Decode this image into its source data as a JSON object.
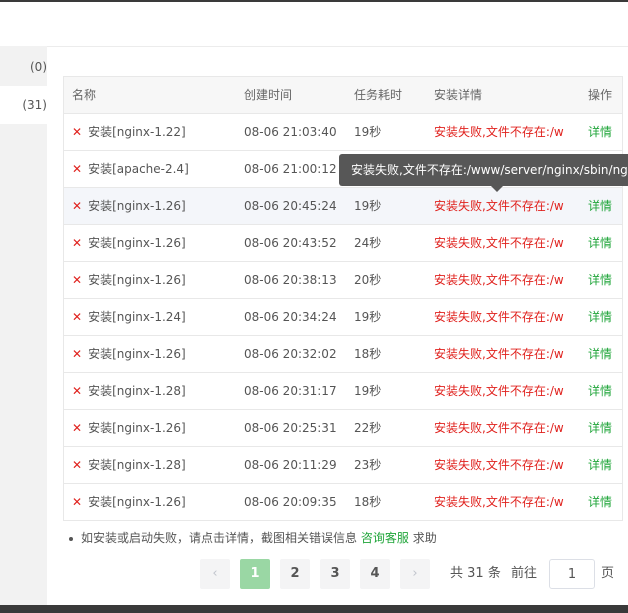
{
  "sidebar": {
    "items": [
      {
        "label": "(0)",
        "active": false
      },
      {
        "label": "(31)",
        "active": true
      },
      {
        "label": "",
        "active": false
      }
    ]
  },
  "table": {
    "headers": {
      "name": "名称",
      "time": "创建时间",
      "duration": "任务耗时",
      "detail": "安装详情",
      "op": "操作"
    },
    "rows": [
      {
        "status": "✕",
        "name": "安装[nginx-1.22]",
        "time": "08-06 21:03:40",
        "duration": "19秒",
        "detail": "安装失败,文件不存在:/www/server/nginx/sbin/nginx",
        "op": "详情"
      },
      {
        "status": "✕",
        "name": "安装[apache-2.4]",
        "time": "08-06 21:00:12",
        "duration": "",
        "detail": "",
        "op": ""
      },
      {
        "status": "✕",
        "name": "安装[nginx-1.26]",
        "time": "08-06 20:45:24",
        "duration": "19秒",
        "detail": "安装失败,文件不存在:/www/server/nginx/sbin/nginx",
        "op": "详情"
      },
      {
        "status": "✕",
        "name": "安装[nginx-1.26]",
        "time": "08-06 20:43:52",
        "duration": "24秒",
        "detail": "安装失败,文件不存在:/www/server/nginx/sbin/nginx",
        "op": "详情"
      },
      {
        "status": "✕",
        "name": "安装[nginx-1.26]",
        "time": "08-06 20:38:13",
        "duration": "20秒",
        "detail": "安装失败,文件不存在:/www/server/nginx/sbin/nginx",
        "op": "详情"
      },
      {
        "status": "✕",
        "name": "安装[nginx-1.24]",
        "time": "08-06 20:34:24",
        "duration": "19秒",
        "detail": "安装失败,文件不存在:/www/server/nginx/sbin/nginx",
        "op": "详情"
      },
      {
        "status": "✕",
        "name": "安装[nginx-1.26]",
        "time": "08-06 20:32:02",
        "duration": "18秒",
        "detail": "安装失败,文件不存在:/www/server/nginx/sbin/nginx",
        "op": "详情"
      },
      {
        "status": "✕",
        "name": "安装[nginx-1.28]",
        "time": "08-06 20:31:17",
        "duration": "19秒",
        "detail": "安装失败,文件不存在:/www/server/nginx/sbin/nginx",
        "op": "详情"
      },
      {
        "status": "✕",
        "name": "安装[nginx-1.26]",
        "time": "08-06 20:25:31",
        "duration": "22秒",
        "detail": "安装失败,文件不存在:/www/server/nginx/sbin/nginx",
        "op": "详情"
      },
      {
        "status": "✕",
        "name": "安装[nginx-1.28]",
        "time": "08-06 20:11:29",
        "duration": "23秒",
        "detail": "安装失败,文件不存在:/www/server/nginx/sbin/nginx",
        "op": "详情"
      },
      {
        "status": "✕",
        "name": "安装[nginx-1.26]",
        "time": "08-06 20:09:35",
        "duration": "18秒",
        "detail": "安装失败,文件不存在:/www/server/nginx/sbin/nginx",
        "op": "详情"
      }
    ]
  },
  "tooltip": {
    "text": "安装失败,文件不存在:/www/server/nginx/sbin/nginx"
  },
  "tip": {
    "text": "如安装或启动失败，请点击详情，截图相关错误信息",
    "link": "咨询客服",
    "suffix": "求助"
  },
  "pagination": {
    "prev_icon": "chevron-left-icon",
    "next_icon": "chevron-right-icon",
    "pages": [
      "1",
      "2",
      "3",
      "4"
    ],
    "current": "1",
    "total_prefix": "共",
    "total_count": "31",
    "total_suffix": "条",
    "goto_label": "前往",
    "goto_value": "1",
    "page_unit": "页"
  },
  "colors": {
    "error": "#e0221e",
    "accent": "#20a53a",
    "active_page": "#9ad7a4"
  }
}
